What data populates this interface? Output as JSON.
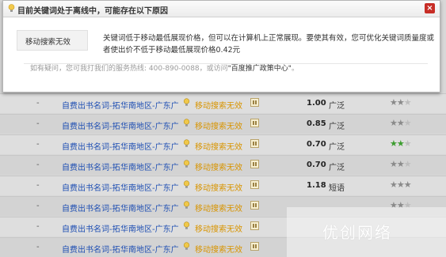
{
  "dialog": {
    "title": "目前关键词处于离线中，可能存在以下原因",
    "close_symbol": "×",
    "reason_label": "移动搜索无效",
    "description": "关键词低于移动最低展现价格，但可以在计算机上正常展现。要使其有效，您可优化关键词质量度或者使出价不低于移动最低展现价格0.42元",
    "help_prefix": "如有疑问，您可我打我们的服务热线: 400-890-0088，或访问",
    "help_link": "\"百度推广政策中心\"",
    "help_suffix": "。"
  },
  "rows": [
    {
      "dash": "-",
      "keyword": "自费出书名词-拓",
      "region": "华南地区-广东广",
      "status": "移动搜索无效",
      "bid": "1.00",
      "match": "广泛",
      "stars": "☆☆☆"
    },
    {
      "dash": "-",
      "keyword": "自费出书名词-拓",
      "region": "华南地区-广东广",
      "status": "移动搜索无效",
      "bid": "0.85",
      "match": "广泛",
      "stars": "☆☆☆"
    },
    {
      "dash": "-",
      "keyword": "自费出书名词-拓",
      "region": "华南地区-广东广",
      "status": "移动搜索无效",
      "bid": "0.70",
      "match": "广泛",
      "stars": "☆☆☆"
    },
    {
      "dash": "-",
      "keyword": "自费出书名词-拓",
      "region": "华南地区-广东广",
      "status": "移动搜索无效",
      "bid": "0.70",
      "match": "广泛",
      "stars": "☆☆☆"
    },
    {
      "dash": "-",
      "keyword": "自费出书名词-拓",
      "region": "华南地区-广东广",
      "status": "移动搜索无效",
      "bid": "1.18",
      "match": "短语",
      "stars": "☆☆☆"
    },
    {
      "dash": "-",
      "keyword": "自费出书名词-拓",
      "region": "华南地区-广东广",
      "status": "移动搜索无效",
      "bid": "",
      "match": "",
      "stars": "☆☆☆"
    },
    {
      "dash": "-",
      "keyword": "自费出书名词-拓",
      "region": "华南地区-广东广",
      "status": "移动搜索无效",
      "bid": "",
      "match": "",
      "stars": ""
    },
    {
      "dash": "-",
      "keyword": "自费出书名词-拓",
      "region": "华南地区-广东广",
      "status": "移动搜索无效",
      "bid": "",
      "match": "",
      "stars": ""
    }
  ],
  "watermark": {
    "text": "优创网络"
  },
  "colors": {
    "link_blue": "#1f4fb3",
    "status_orange": "#d89400",
    "close_red": "#c72d26",
    "star_green": "#3c9d2f"
  }
}
